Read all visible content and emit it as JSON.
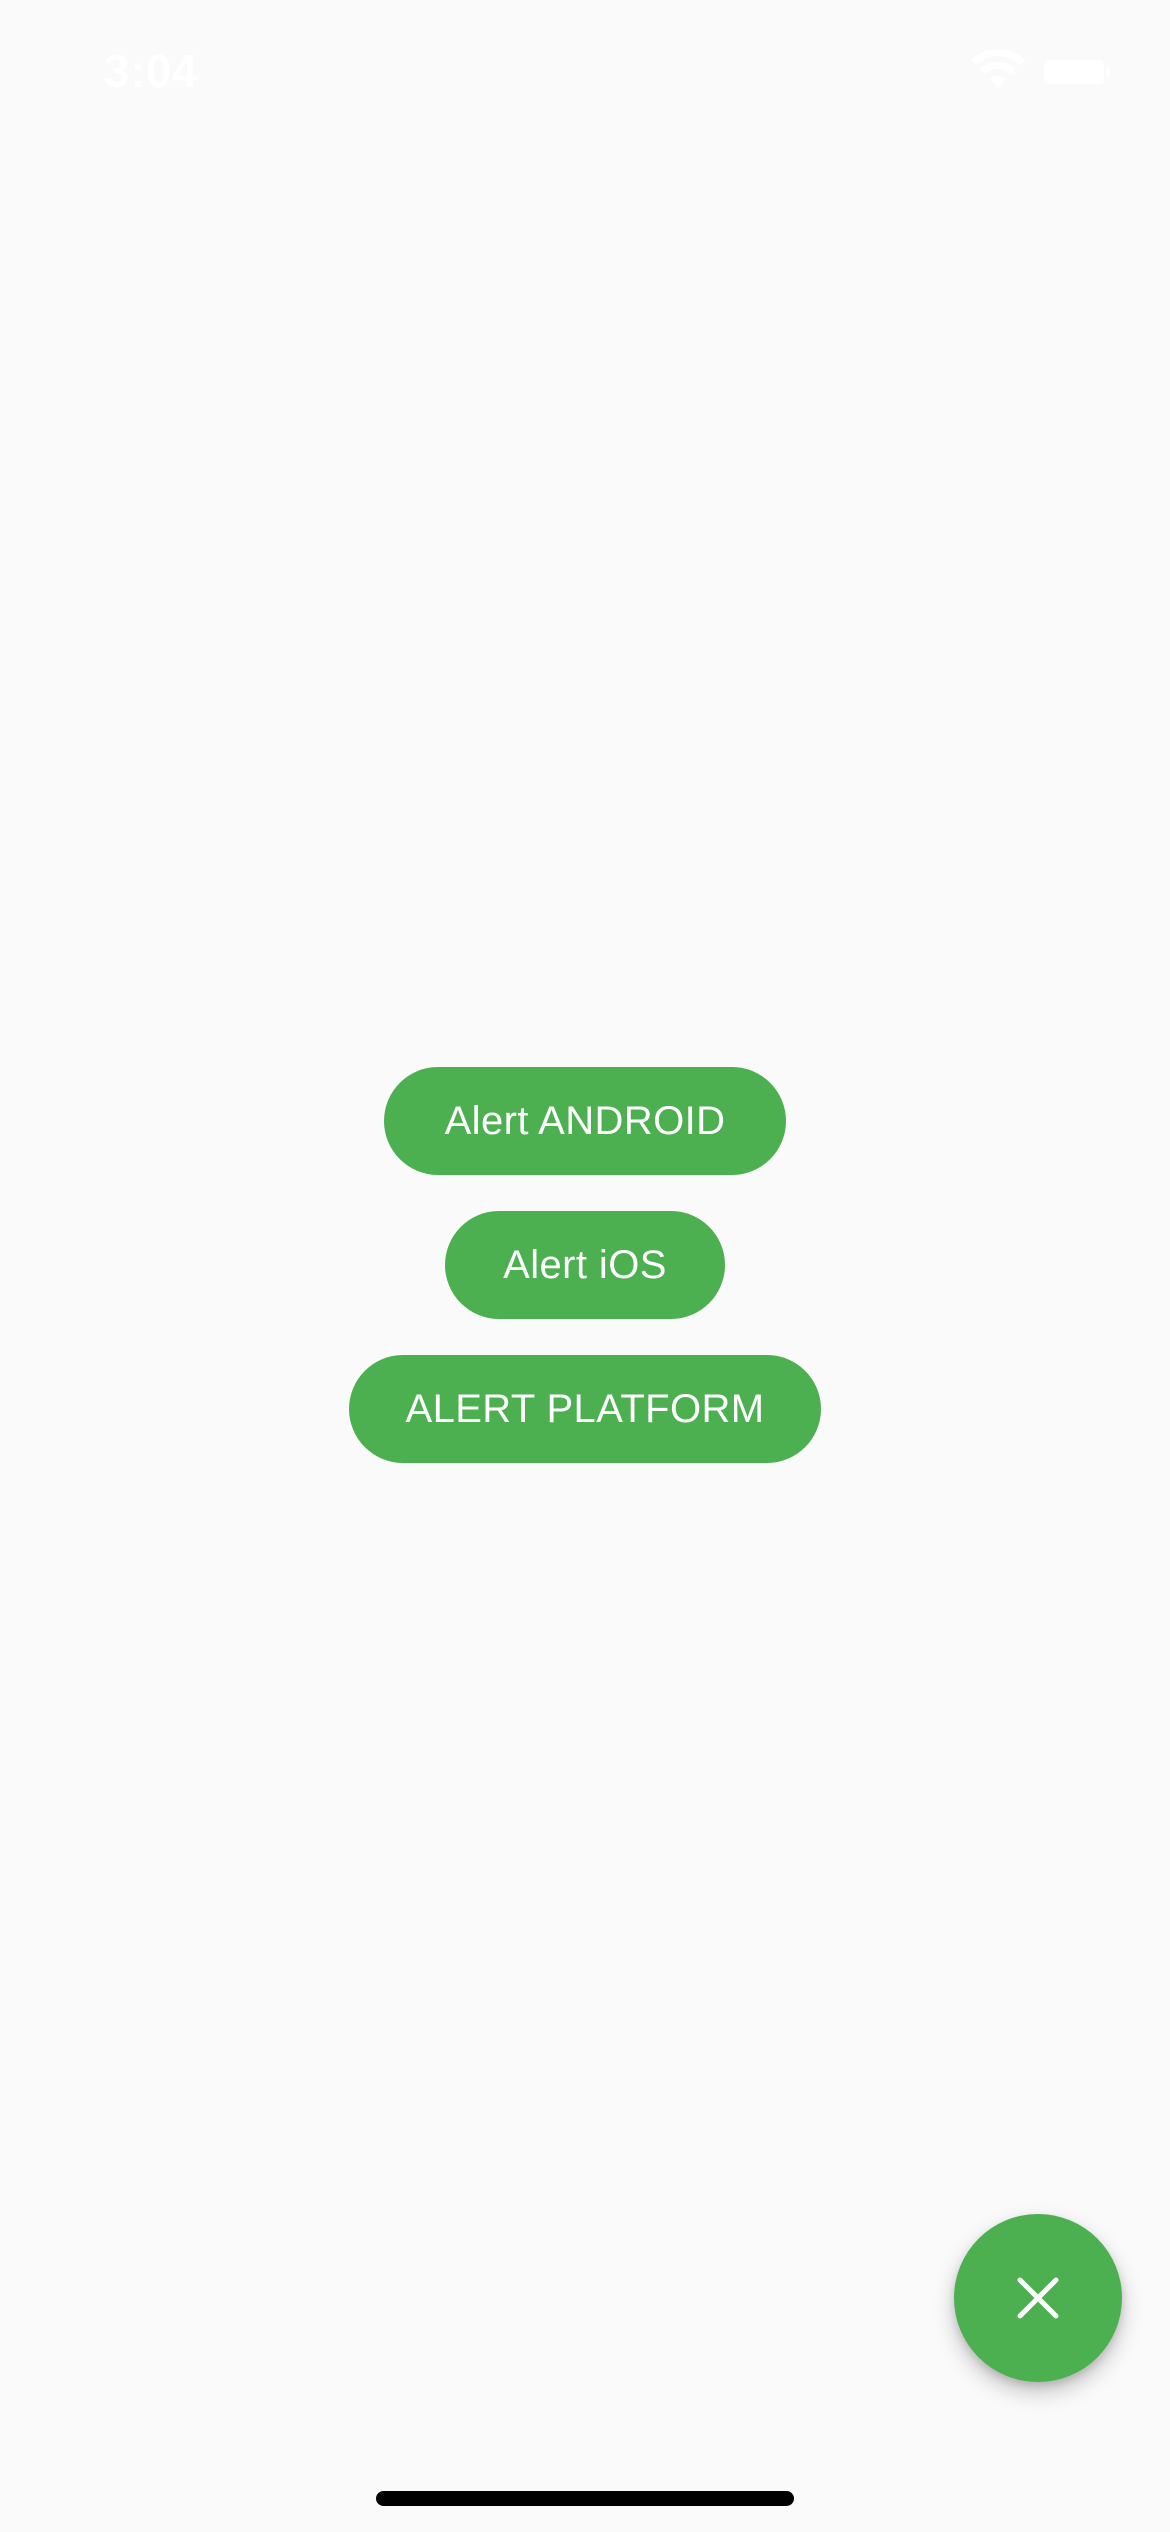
{
  "status_bar": {
    "time": "3:04",
    "icons": [
      "wifi-icon",
      "battery-icon"
    ]
  },
  "main": {
    "buttons": [
      {
        "label": "Alert ANDROID"
      },
      {
        "label": "Alert iOS"
      },
      {
        "label": "ALERT PLATFORM"
      }
    ]
  },
  "fab": {
    "icon": "close-icon"
  },
  "colors": {
    "accent": "#4CAF50",
    "background": "#FAFAFA",
    "button_text": "#FFFFFF"
  }
}
